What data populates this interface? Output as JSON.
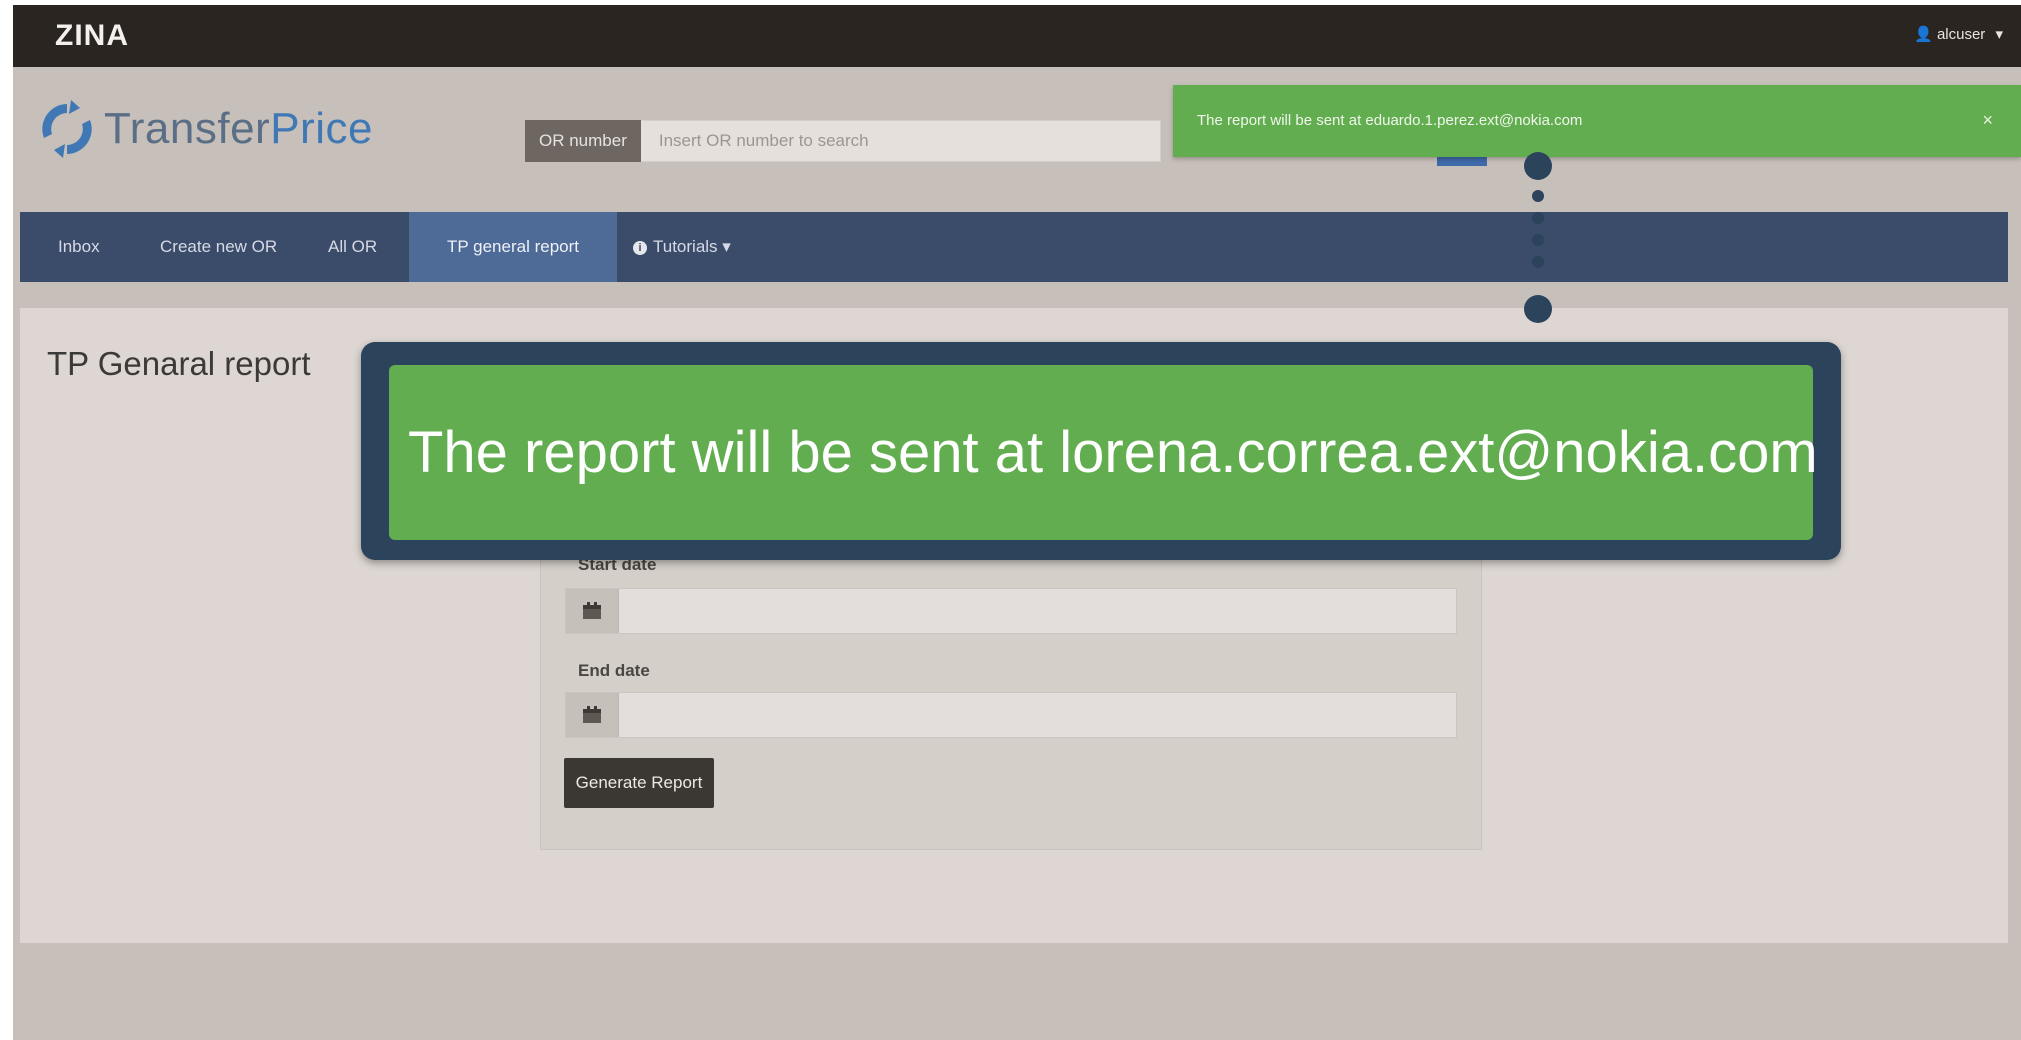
{
  "topbar": {
    "brand": "ZINA",
    "user": "alcuser",
    "user_icon": "user-icon"
  },
  "logo": {
    "text_main": "Transfer",
    "text_accent": "Price",
    "icon": "refresh-arrows-icon"
  },
  "search": {
    "label": "OR number",
    "placeholder": "Insert OR number to search"
  },
  "nav": {
    "items": [
      {
        "label": "Inbox"
      },
      {
        "label": "Create new OR"
      },
      {
        "label": "All OR"
      },
      {
        "label": "TP general report"
      },
      {
        "label": "Tutorials",
        "icon": "info-circle-icon"
      }
    ],
    "active": "TP general report"
  },
  "page": {
    "title": "TP Genaral report"
  },
  "form": {
    "start_label": "Start date",
    "end_label": "End date",
    "calendar_icon": "calendar-icon",
    "generate_label": "Generate Report"
  },
  "toast": {
    "message": "The report will be sent at eduardo.1.perez.ext@nokia.com",
    "close": "×"
  },
  "callout": {
    "message": "The report will be sent at lorena.correa.ext@nokia.com"
  },
  "colors": {
    "topbar": "#2a2521",
    "nav": "#3b4b6a",
    "nav_active": "#4e6a97",
    "toast_green": "#62ad4f",
    "callout_border": "#2c435c"
  }
}
